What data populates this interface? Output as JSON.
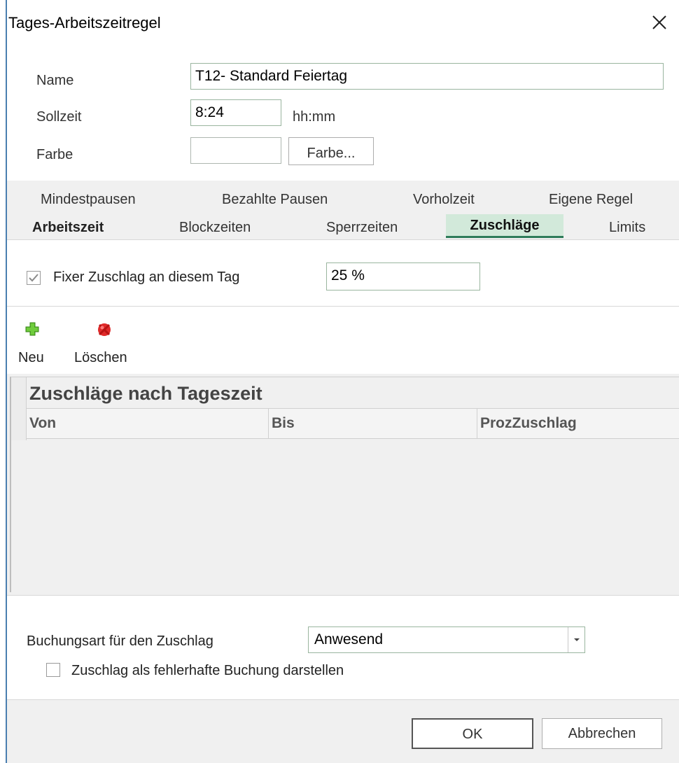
{
  "window": {
    "title": "Tages-Arbeitszeitregel"
  },
  "header": {
    "name_label": "Name",
    "name_value": "T12- Standard Feiertag",
    "sollzeit_label": "Sollzeit",
    "sollzeit_value": "8:24",
    "sollzeit_unit": "hh:mm",
    "farbe_label": "Farbe",
    "farbe_button": "Farbe..."
  },
  "tabs": {
    "row1": [
      "Mindestpausen",
      "Bezahlte Pausen",
      "Vorholzeit",
      "Eigene Regel"
    ],
    "row2": [
      "Arbeitszeit",
      "Blockzeiten",
      "Sperrzeiten",
      "Zuschläge",
      "Limits"
    ],
    "active": "Zuschläge"
  },
  "fixed_surcharge": {
    "checked": true,
    "label": "Fixer Zuschlag an diesem Tag",
    "value": "25 %"
  },
  "toolbar": {
    "new_label": "Neu",
    "delete_label": "Löschen"
  },
  "grid": {
    "caption": "Zuschläge nach Tageszeit",
    "columns": [
      "Von",
      "Bis",
      "ProzZuschlag"
    ],
    "rows": []
  },
  "booking": {
    "label": "Buchungsart für den Zuschlag",
    "selected": "Anwesend",
    "error_checkbox_label": "Zuschlag als fehlerhafte Buchung darstellen",
    "error_checkbox_checked": false
  },
  "footer": {
    "ok_label": "OK",
    "cancel_label": "Abbrechen"
  },
  "colors": {
    "accent": "#2e7c5a",
    "active_tab_bg": "#d2e9da",
    "field_border": "#9ab59f",
    "new_icon": "#5cb82e",
    "delete_icon": "#e02a2a"
  }
}
